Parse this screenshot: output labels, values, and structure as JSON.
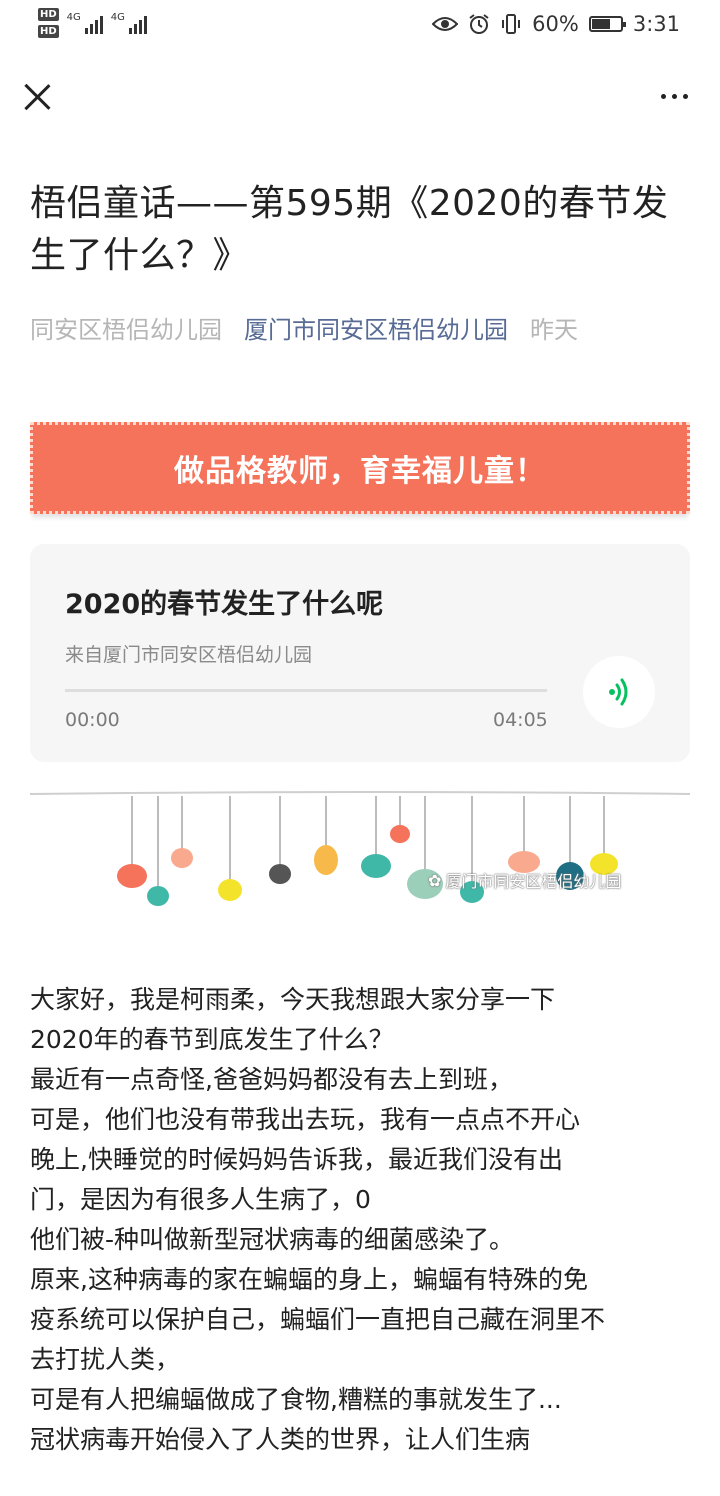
{
  "status_bar": {
    "hd1": "HD",
    "hd2": "HD",
    "net1": "4G",
    "net2": "4G",
    "battery_text": "60%",
    "battery_level": 0.6,
    "time": "3:31",
    "icons": [
      "eye-icon",
      "alarm-icon",
      "vibrate-icon",
      "battery-icon"
    ]
  },
  "nav": {
    "close_icon": "close-icon",
    "more_icon": "more-icon"
  },
  "article": {
    "title": "梧侣童话——第595期《2020的春节发生了什么？》",
    "author": "同安区梧侣幼儿园",
    "account": "厦门市同安区梧侣幼儿园",
    "date": "昨天"
  },
  "banner": {
    "text": "做品格教师，育幸福儿童！",
    "color": "#f4735a"
  },
  "audio": {
    "title": "2020的春节发生了什么呢",
    "source": "来自厦门市同安区梧侣幼儿园",
    "current_time": "00:00",
    "duration": "04:05",
    "progress": 0,
    "accent_color": "#07c160"
  },
  "illustration": {
    "watermark": "厦门市同安区梧侣幼儿园"
  },
  "body": {
    "paragraphs": [
      "大家好，我是柯雨柔，今天我想跟大家分享一下",
      "2020年的春节到底发生了什么？",
      "最近有一点奇怪,爸爸妈妈都没有去上到班，",
      "可是，他们也没有带我出去玩，我有一点点不开心",
      "晚上,快睡觉的时候妈妈告诉我，最近我们没有出",
      "门，是因为有很多人生病了，0",
      "他们被-种叫做新型冠状病毒的细菌感染了。",
      "原来,这种病毒的家在蝙蝠的身上，蝙蝠有特殊的免",
      "疫系统可以保护自己，蝙蝠们一直把自己藏在洞里不",
      "去打扰人类，",
      "可是有人把编蝠做成了食物,糟糕的事就发生了...",
      "冠状病毒开始侵入了人类的世界，让人们生病"
    ]
  }
}
